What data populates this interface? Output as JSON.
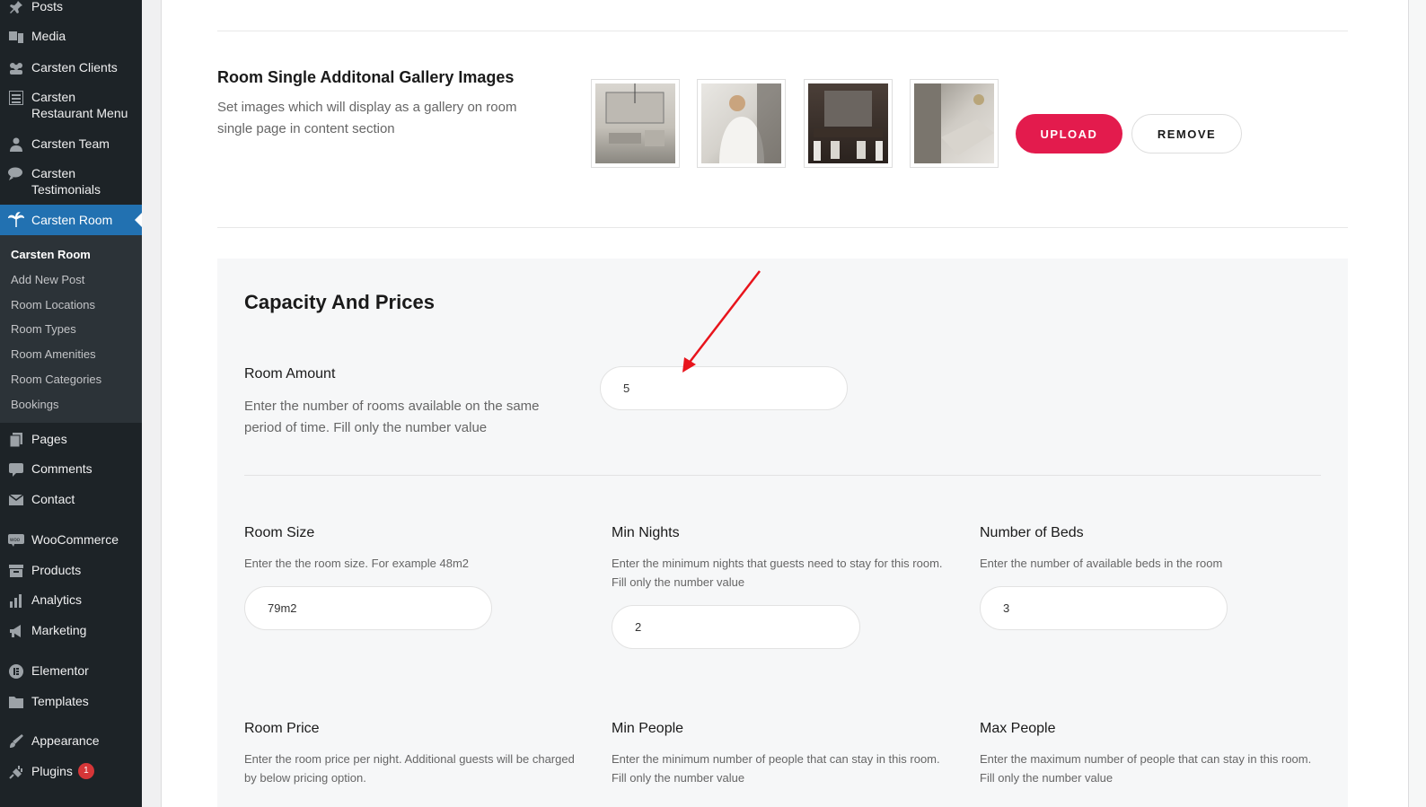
{
  "sidebar": {
    "items": [
      {
        "label": "Posts",
        "icon": "pin-icon"
      },
      {
        "label": "Media",
        "icon": "media-icon"
      },
      {
        "label": "Carsten Clients",
        "icon": "users-icon"
      },
      {
        "label": "Carsten Restaurant Menu",
        "icon": "list-icon"
      },
      {
        "label": "Carsten Team",
        "icon": "user-icon"
      },
      {
        "label": "Carsten Testimonials",
        "icon": "chat-icon"
      },
      {
        "label": "Carsten Room",
        "icon": "palm-icon"
      },
      {
        "label": "Pages",
        "icon": "pages-icon"
      },
      {
        "label": "Comments",
        "icon": "comment-icon"
      },
      {
        "label": "Contact",
        "icon": "mail-icon"
      },
      {
        "label": "WooCommerce",
        "icon": "woo-icon"
      },
      {
        "label": "Products",
        "icon": "products-icon"
      },
      {
        "label": "Analytics",
        "icon": "chart-icon"
      },
      {
        "label": "Marketing",
        "icon": "megaphone-icon"
      },
      {
        "label": "Elementor",
        "icon": "elementor-icon"
      },
      {
        "label": "Templates",
        "icon": "folder-icon"
      },
      {
        "label": "Appearance",
        "icon": "brush-icon"
      },
      {
        "label": "Plugins",
        "icon": "plug-icon",
        "badge": "1"
      }
    ],
    "submenu": [
      "Carsten Room",
      "Add New Post",
      "Room Locations",
      "Room Types",
      "Room Amenities",
      "Room Categories",
      "Bookings"
    ]
  },
  "gallery": {
    "title": "Room Single Additonal Gallery Images",
    "description_line1": "Set images which will display as a gallery on room",
    "description_line2": "single page in content section",
    "upload_label": "UPLOAD",
    "remove_label": "REMOVE"
  },
  "capacity": {
    "title": "Capacity And Prices",
    "room_amount": {
      "label": "Room Amount",
      "desc_line1": "Enter the number of rooms available on the same",
      "desc_line2": "period of time. Fill only the number value",
      "value": "5"
    },
    "room_size": {
      "label": "Room Size",
      "desc_line1": "Enter the the room size. For example 48m2",
      "value": "79m2"
    },
    "min_nights": {
      "label": "Min Nights",
      "desc_line1": "Enter the minimum nights that guests need to stay for this room.",
      "desc_line2": "Fill only the number value",
      "value": "2"
    },
    "number_of_beds": {
      "label": "Number of Beds",
      "desc_line1": "Enter the number of available beds in the room",
      "value": "3"
    },
    "room_price": {
      "label": "Room Price",
      "desc_line1": "Enter the room price per night. Additional guests will be charged",
      "desc_line2": "by below pricing option."
    },
    "min_people": {
      "label": "Min People",
      "desc_line1": "Enter the minimum number of people that can stay in this room.",
      "desc_line2": "Fill only the number value"
    },
    "max_people": {
      "label": "Max People",
      "desc_line1": "Enter the maximum number of people that can stay in this room.",
      "desc_line2": "Fill only the number value"
    }
  },
  "colors": {
    "accent": "#e31b4d",
    "sidebar_bg": "#1d2327",
    "active": "#2271b1",
    "annotation": "#e8141c"
  }
}
